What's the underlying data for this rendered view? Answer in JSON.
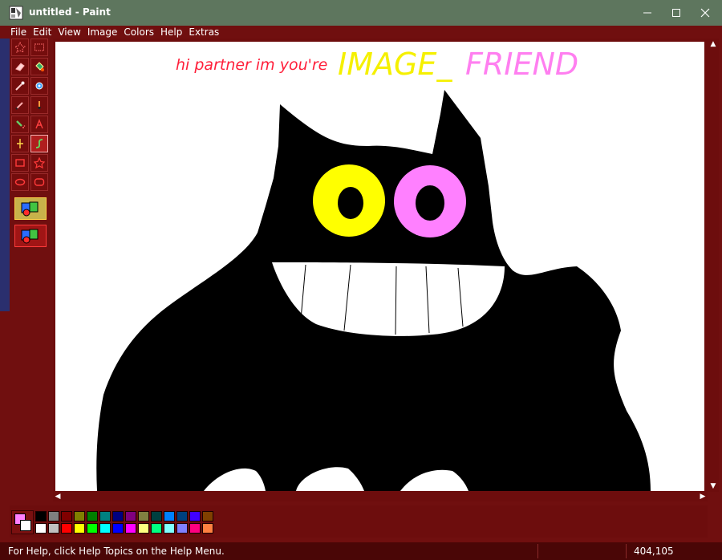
{
  "window": {
    "title": "untitled - Paint",
    "icon": "paint-app-icon",
    "controls": [
      "minimize",
      "maximize",
      "close"
    ]
  },
  "menubar": {
    "items": [
      "File",
      "Edit",
      "View",
      "Image",
      "Colors",
      "Help",
      "Extras"
    ]
  },
  "toolbox": {
    "tools": [
      "free-form-select",
      "rectangle-select",
      "eraser",
      "fill-with-color",
      "pick-color",
      "magnifier",
      "pencil",
      "brush",
      "airbrush",
      "text",
      "line",
      "curve",
      "rectangle",
      "polygon",
      "ellipse",
      "rounded-rectangle"
    ],
    "selected_tool": "curve"
  },
  "canvas": {
    "greeting": "hi partner im you're",
    "name_part1": "IMAGE_",
    "name_part2": "FRIEND",
    "colors": {
      "greeting": "#ff1f3a",
      "name_part1": "#f5f000",
      "name_part2": "#ff7ff0",
      "creature": "#000000",
      "left_eye": "#ffff00",
      "right_eye": "#ff80ff",
      "teeth": "#ffffff"
    }
  },
  "palette": {
    "foreground": "#ff80ff",
    "background": "#ffffff",
    "colors": [
      "#000000",
      "#808080",
      "#800000",
      "#808000",
      "#008000",
      "#008080",
      "#000080",
      "#800080",
      "#808040",
      "#004040",
      "#0080ff",
      "#004080",
      "#4000ff",
      "#804000",
      "#ffffff",
      "#c0c0c0",
      "#ff0000",
      "#ffff00",
      "#00ff00",
      "#00ffff",
      "#0000ff",
      "#ff00ff",
      "#ffff80",
      "#00ff80",
      "#80ffff",
      "#8080ff",
      "#ff0080",
      "#ff8040"
    ]
  },
  "statusbar": {
    "help_text": "For Help, click Help Topics on the Help Menu.",
    "coordinates": "404,105"
  },
  "theme": {
    "titlebar": "#5e765e",
    "frame": "#700f0f",
    "statusbar": "#4a0606"
  }
}
